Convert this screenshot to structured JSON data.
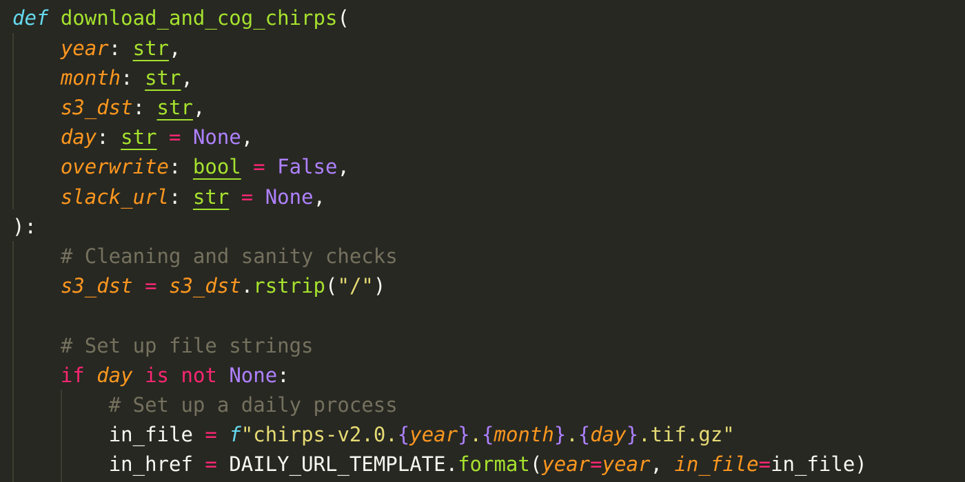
{
  "code": {
    "l1": {
      "kw": "def",
      "fn": "download_and_cog_chirps",
      "open": "("
    },
    "l2": {
      "param": "year",
      "colon": ":",
      "type": "str",
      "comma": ","
    },
    "l3": {
      "param": "month",
      "colon": ":",
      "type": "str",
      "comma": ","
    },
    "l4": {
      "param": "s3_dst",
      "colon": ":",
      "type": "str",
      "comma": ","
    },
    "l5": {
      "param": "day",
      "colon": ":",
      "type": "str",
      "eq": "=",
      "default": "None",
      "comma": ","
    },
    "l6": {
      "param": "overwrite",
      "colon": ":",
      "type": "bool",
      "eq": "=",
      "default": "False",
      "comma": ","
    },
    "l7": {
      "param": "slack_url",
      "colon": ":",
      "type": "str",
      "eq": "=",
      "default": "None",
      "comma": ","
    },
    "l8": {
      "close": "):"
    },
    "l9": {
      "comment": "# Cleaning and sanity checks"
    },
    "l10": {
      "var": "s3_dst",
      "eq": "=",
      "obj": "s3_dst",
      "dot": ".",
      "method": "rstrip",
      "open": "(",
      "arg": "\"/\"",
      "close": ")"
    },
    "l12": {
      "comment": "# Set up file strings"
    },
    "l13": {
      "kw_if": "if",
      "var": "day",
      "kw_is": "is",
      "kw_not": "not",
      "const": "None",
      "colon": ":"
    },
    "l14": {
      "comment": "# Set up a daily process"
    },
    "l15": {
      "var": "in_file",
      "eq": "=",
      "prefix": "f",
      "q1": "\"chirps-v2.0.",
      "b1o": "{",
      "v1": "year",
      "b1c": "}",
      "d1": ".",
      "b2o": "{",
      "v2": "month",
      "b2c": "}",
      "d2": ".",
      "b3o": "{",
      "v3": "day",
      "b3c": "}",
      "tail": ".tif.gz\""
    },
    "l16": {
      "var": "in_href",
      "eq": "=",
      "obj": "DAILY_URL_TEMPLATE",
      "dot": ".",
      "method": "format",
      "open": "(",
      "k1": "year",
      "e1": "=",
      "a1": "year",
      "sep": ", ",
      "k2": "in_file",
      "e2": "=",
      "a2": "in_file",
      "close": ")"
    }
  }
}
